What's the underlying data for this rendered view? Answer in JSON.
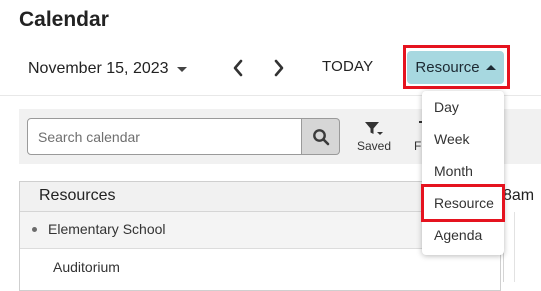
{
  "header": {
    "title": "Calendar"
  },
  "toolbar": {
    "date_label": "November 15, 2023",
    "today_label": "TODAY",
    "view_label": "Resource",
    "view_options": [
      "Day",
      "Week",
      "Month",
      "Resource",
      "Agenda"
    ]
  },
  "filters": {
    "search_placeholder": "Search calendar",
    "saved_label": "Saved",
    "partial_filter_label": "F"
  },
  "resources": {
    "header_label": "Resources",
    "groups": [
      {
        "label": "Elementary School",
        "items": [
          "Auditorium"
        ]
      }
    ]
  },
  "schedule": {
    "first_time_label": "8am"
  },
  "colors": {
    "accent": "#a7d8e0",
    "highlight_outline": "#e5131f",
    "toolbar_bg": "#f1f1f1"
  }
}
